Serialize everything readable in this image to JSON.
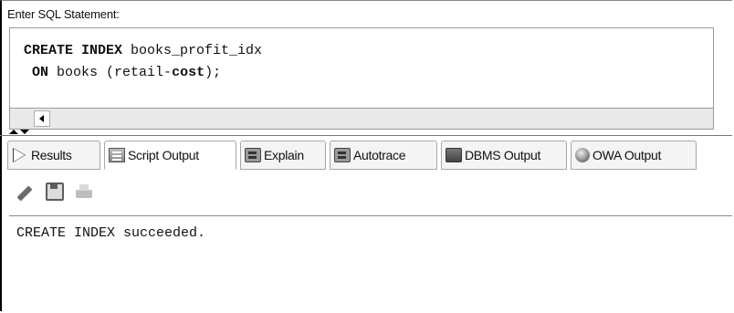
{
  "editor": {
    "label": "Enter SQL Statement:",
    "lines": [
      {
        "kw1": "CREATE INDEX",
        "rest1": " books_profit_idx"
      },
      {
        "kw1": "ON",
        "rest1": " books (retail-",
        "kw2": "cost",
        "rest2": ");"
      }
    ]
  },
  "tabs": [
    {
      "label": "Results",
      "icon": "play-icon"
    },
    {
      "label": "Script Output",
      "icon": "script-icon"
    },
    {
      "label": "Explain",
      "icon": "explain-icon"
    },
    {
      "label": "Autotrace",
      "icon": "autotrace-icon"
    },
    {
      "label": "DBMS Output",
      "icon": "dbms-icon"
    },
    {
      "label": "OWA Output",
      "icon": "globe-icon"
    }
  ],
  "active_tab": "Script Output",
  "toolbar": {
    "icons": [
      "eraser-icon",
      "save-icon",
      "print-icon"
    ]
  },
  "output": {
    "text": "CREATE INDEX succeeded."
  }
}
